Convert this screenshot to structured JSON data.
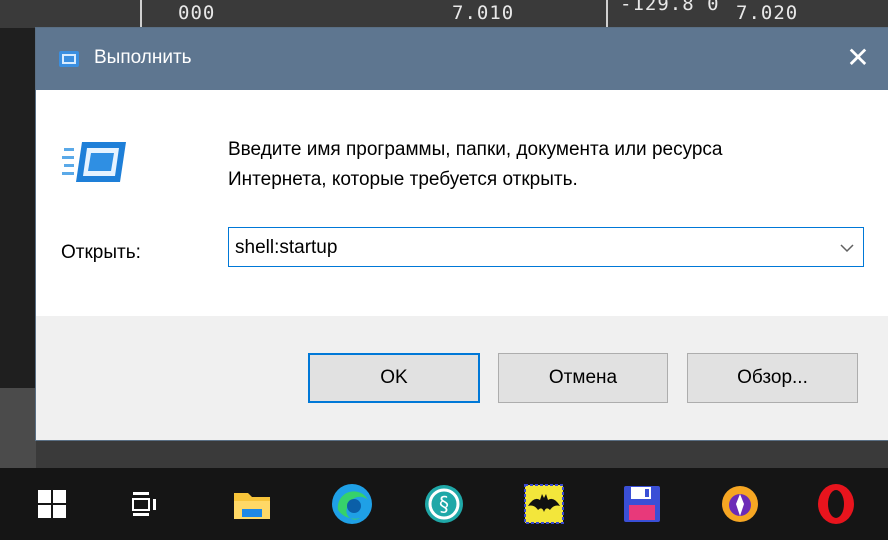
{
  "background": {
    "cells": [
      "000",
      "7.010",
      "-129.8 0",
      "7.020"
    ]
  },
  "dialog": {
    "title": "Выполнить",
    "close_symbol": "✕",
    "description_line1": "Введите имя программы, папки, документа или ресурса",
    "description_line2": "Интернета, которые требуется открыть.",
    "open_label": "Открыть:",
    "open_value": "shell:startup",
    "buttons": {
      "ok": "OK",
      "cancel": "Отмена",
      "browse": "Обзор..."
    },
    "colors": {
      "titlebar": "#5e7690",
      "focus_border": "#0078d7"
    }
  },
  "taskbar": {
    "items": [
      {
        "icon": "windows-start-icon"
      },
      {
        "icon": "task-view-icon"
      },
      {
        "icon": "file-explorer-icon"
      },
      {
        "icon": "edge-icon"
      },
      {
        "icon": "teal-circle-app-icon"
      },
      {
        "icon": "batman-app-icon"
      },
      {
        "icon": "floppy-save-icon"
      },
      {
        "icon": "tor-browser-icon"
      },
      {
        "icon": "opera-icon"
      }
    ]
  }
}
